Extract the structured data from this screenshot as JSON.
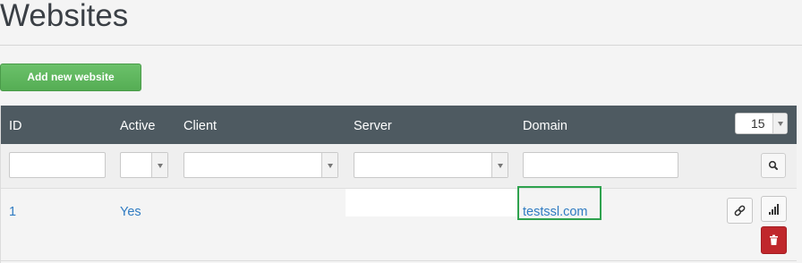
{
  "page": {
    "title": "Websites"
  },
  "toolbar": {
    "add_label": "Add new website"
  },
  "table": {
    "columns": [
      "ID",
      "Active",
      "Client",
      "Server",
      "Domain"
    ],
    "per_page": "15",
    "rows": [
      {
        "id": "1",
        "active": "Yes",
        "client": "",
        "server": "",
        "domain": "testssl.com"
      }
    ]
  },
  "colors": {
    "header_bg": "#4e5a61",
    "add_button": "#5cb85c",
    "link": "#2f7bc2",
    "delete_button": "#c0272c",
    "highlight": "#2ea24e"
  },
  "icons": [
    "search-icon",
    "link-icon",
    "stats-icon",
    "trash-icon",
    "chevron-down-icon"
  ]
}
